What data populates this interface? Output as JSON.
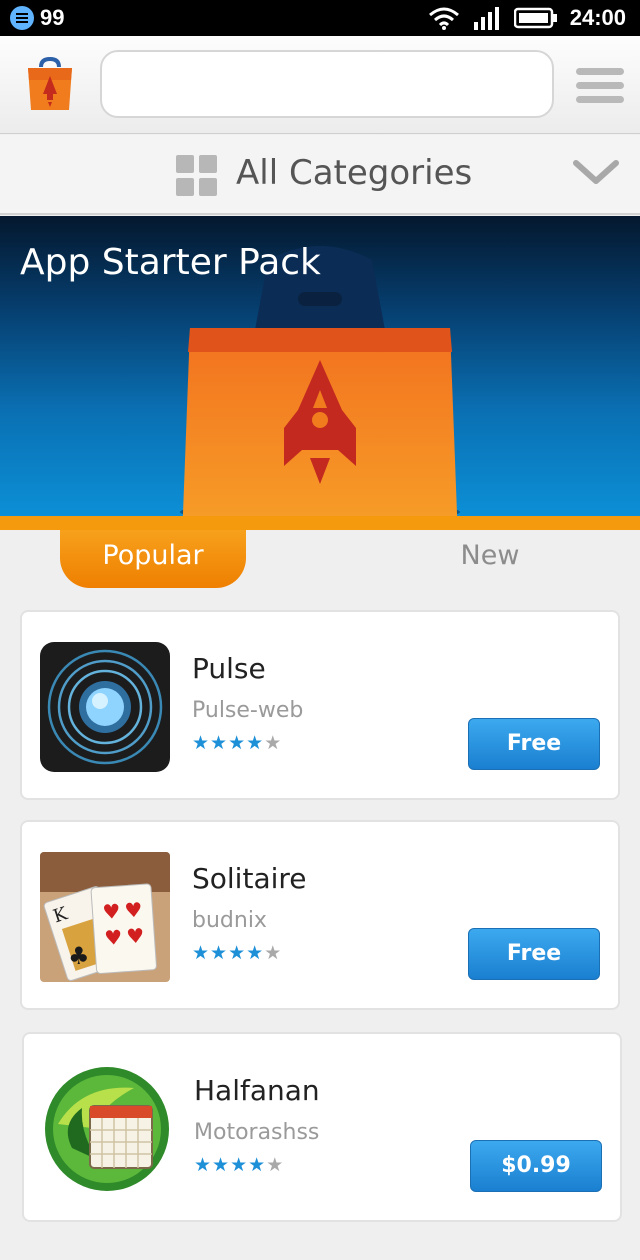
{
  "status_bar": {
    "notification_count": "99",
    "time": "24:00",
    "icons": [
      "notification-icon",
      "wifi-icon",
      "signal-icon",
      "battery-icon"
    ]
  },
  "header": {
    "logo": "marketplace-logo",
    "search": {
      "value": "",
      "placeholder": ""
    },
    "menu_icon": "menu-icon"
  },
  "categories": {
    "label": "All Categories",
    "icon": "grid-icon",
    "chevron": "chevron-down-icon"
  },
  "banner": {
    "title": "App Starter Pack"
  },
  "tabs": [
    {
      "label": "Popular",
      "active": true
    },
    {
      "label": "New",
      "active": false
    }
  ],
  "apps": [
    {
      "name": "Pulse",
      "developer": "Pulse-web",
      "rating": 4,
      "rating_max": 5,
      "price": "Free"
    },
    {
      "name": "Solitaire",
      "developer": "budnix",
      "rating": 4,
      "rating_max": 5,
      "price": "Free"
    },
    {
      "name": "Halfanan",
      "developer": "Motorashss",
      "rating": 4,
      "rating_max": 5,
      "price": "$0.99"
    }
  ],
  "colors": {
    "accent_orange": "#f59a0c",
    "button_blue": "#1e8fe0",
    "star_blue": "#1e90d8",
    "banner_blue": "#0a70b3"
  }
}
